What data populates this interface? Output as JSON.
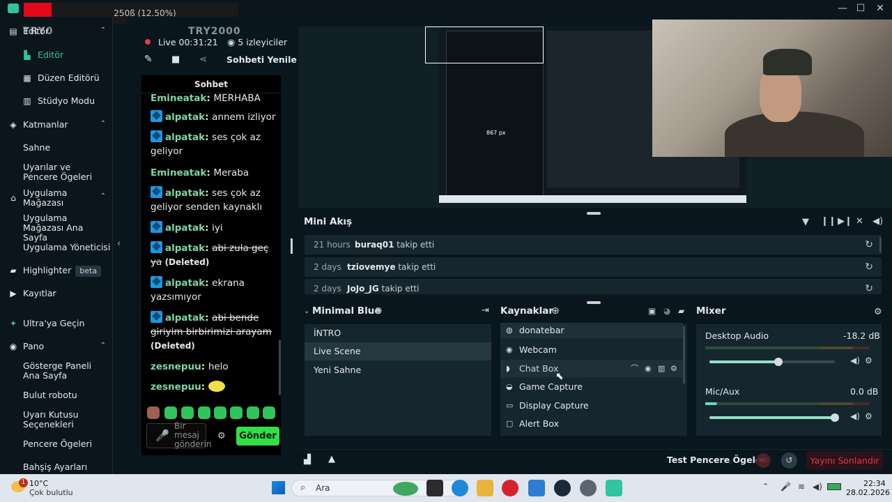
{
  "titlebar": {
    "progress_text": "250ß (12.50%)",
    "minimize": "—",
    "maximize": "☐",
    "close": "✕"
  },
  "sidebar": {
    "header_text": "TRY0",
    "overlay_text": "Editör",
    "items": [
      {
        "label": "Editör"
      },
      {
        "label": "Düzen Editörü"
      },
      {
        "label": "Stüdyo Modu"
      },
      {
        "label": "Katmanlar"
      },
      {
        "label": "Sahne"
      },
      {
        "label": "Uyarılar ve Pencere Ögeleri"
      },
      {
        "label": "Uygulama Mağazası"
      },
      {
        "label": "Uygulama Mağazası Ana Sayfa"
      },
      {
        "label": "Uygulama Yöneticisi"
      },
      {
        "label": "Highlighter"
      },
      {
        "label": "Kayıtlar"
      },
      {
        "label": "Ultra'ya Geçin"
      },
      {
        "label": "Pano"
      },
      {
        "label": "Gösterge Paneli Ana Sayfa"
      },
      {
        "label": "Bulut robotu"
      },
      {
        "label": "Uyarı Kutusu Seçenekleri"
      },
      {
        "label": "Pencere Ögeleri"
      },
      {
        "label": "Bahşiş Ayarları"
      }
    ],
    "beta": "beta"
  },
  "chat": {
    "channel": "TRY2000",
    "live_label": "Live",
    "live_time": "00:31:21",
    "viewers": "5 izleyiciler",
    "refresh": "Sohbeti Yenile",
    "title": "Sohbet",
    "messages": [
      {
        "user": "Emineatak",
        "text": "MERHABA"
      },
      {
        "user": "alpatak",
        "text": "annem izliyor"
      },
      {
        "user": "alpatak",
        "text": "ses çok az geliyor"
      },
      {
        "user": "Emineatak",
        "text": "Meraba"
      },
      {
        "user": "alpatak",
        "text": "ses çok az geliyor senden kaynaklı"
      },
      {
        "user": "alpatak",
        "text": "iyi"
      },
      {
        "user": "alpatak",
        "text": "abi zula geç ya",
        "deleted": "(Deleted)"
      },
      {
        "user": "alpatak",
        "text": "ekrana yazsımıyor"
      },
      {
        "user": "alpatak",
        "text": "abi bende giriyim birbirimizi arayam",
        "deleted": "(Deleted)"
      },
      {
        "user": "zesnepuu",
        "text": "helo"
      },
      {
        "user": "zesnepuu",
        "text": ""
      }
    ],
    "input_placeholder": "Bir mesaj gönderin",
    "send": "Gönder"
  },
  "mini_feed": {
    "title": "Mini Akış",
    "rows": [
      {
        "time": "21 hours",
        "user": "buraq01",
        "action": "takip etti"
      },
      {
        "time": "2 days",
        "user": "tziovemye",
        "action": "takip etti"
      },
      {
        "time": "2 days",
        "user": "JoJo_JG",
        "action": "takip etti"
      }
    ]
  },
  "scenes": {
    "title": "Minimal Blue",
    "items": [
      "İNTRO",
      "Live Scene",
      "Yeni Sahne"
    ]
  },
  "sources": {
    "title": "Kaynaklar",
    "items": [
      "donatebar",
      "Webcam",
      "Chat Box",
      "Game Capture",
      "Display Capture",
      "Alert Box"
    ]
  },
  "mixer": {
    "title": "Mixer",
    "channels": [
      {
        "name": "Desktop Audio",
        "db": "-18.2 dB",
        "level": 0.55
      },
      {
        "name": "Mic/Aux",
        "db": "0.0 dB",
        "level": 1.0
      }
    ]
  },
  "bottom": {
    "test_widgets": "Test Pencere Ögeleri",
    "rec": "REC",
    "end_stream": "Yayını Sonlandır"
  },
  "taskbar": {
    "temp": "10°C",
    "weather": "Çok bulutlu",
    "search": "Ara",
    "time": "22:34",
    "date": "28.02.2026",
    "notif": "1"
  },
  "preview": {
    "overlay_text": "867 px"
  }
}
